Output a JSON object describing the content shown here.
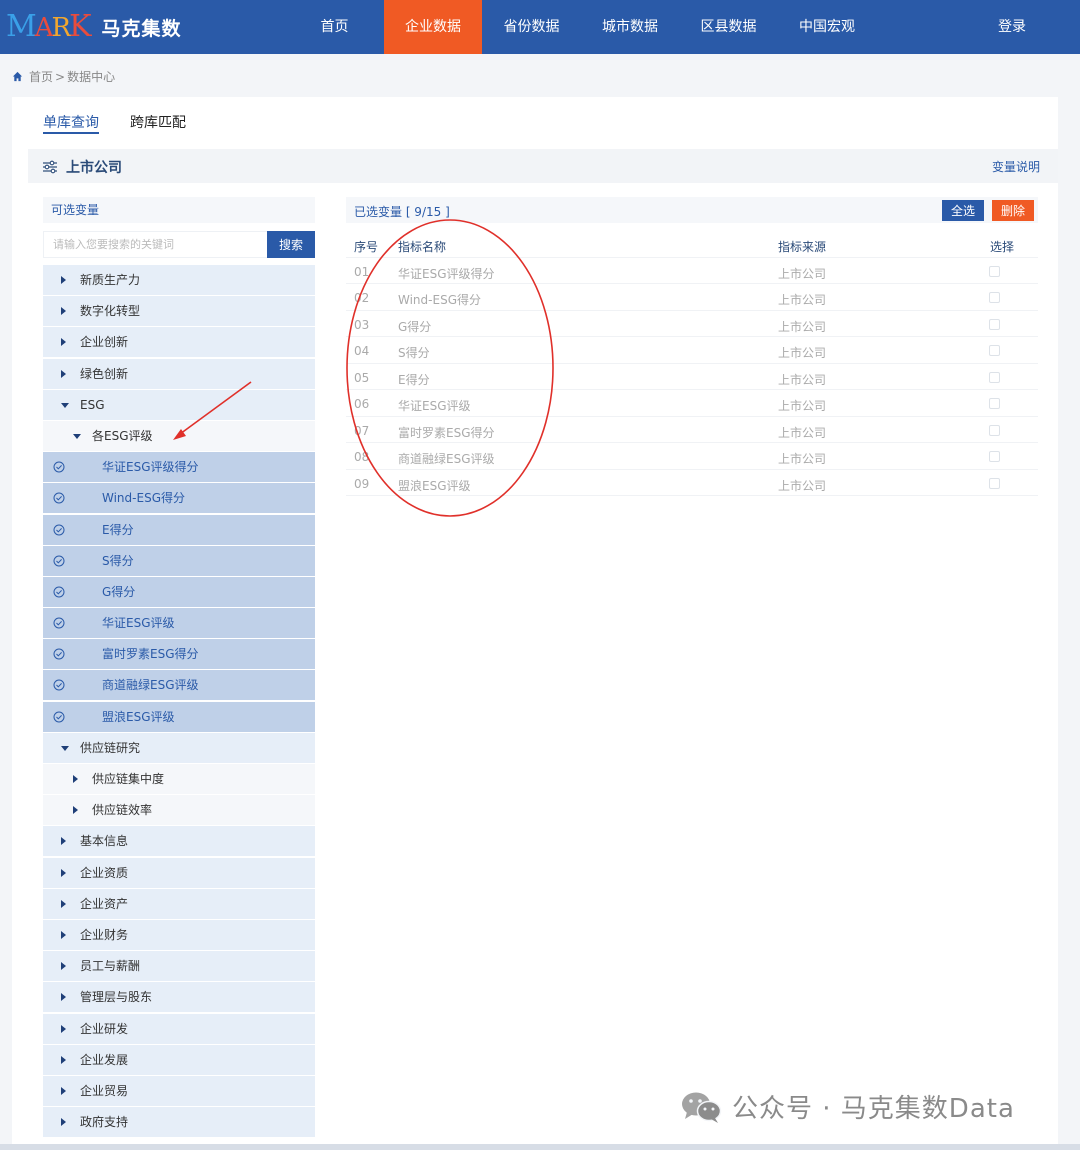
{
  "brand": {
    "logo_text": "MARK",
    "name": "马克集数"
  },
  "nav": {
    "items": [
      "首页",
      "企业数据",
      "省份数据",
      "城市数据",
      "区县数据",
      "中国宏观"
    ],
    "active": "企业数据",
    "login": "登录"
  },
  "breadcrumb": {
    "home": "首页",
    "separator": ">",
    "current": "数据中心"
  },
  "tabs": {
    "single": "单库查询",
    "cross": "跨库匹配"
  },
  "section": {
    "title": "上市公司",
    "explain_link": "变量说明"
  },
  "left_panel": {
    "header": "可选变量",
    "search_placeholder": "请输入您要搜索的关键词",
    "search_button": "搜索",
    "tree": [
      {
        "label": "新质生产力",
        "level": 1,
        "expanded": false
      },
      {
        "label": "数字化转型",
        "level": 1,
        "expanded": false
      },
      {
        "label": "企业创新",
        "level": 1,
        "expanded": false
      },
      {
        "label": "绿色创新",
        "level": 1,
        "expanded": false
      },
      {
        "label": "ESG",
        "level": 1,
        "expanded": true
      },
      {
        "label": "各ESG评级",
        "level": 2,
        "expanded": true
      },
      {
        "label": "华证ESG评级得分",
        "level": 3,
        "checked": true
      },
      {
        "label": "Wind-ESG得分",
        "level": 3,
        "checked": true
      },
      {
        "label": "E得分",
        "level": 3,
        "checked": true
      },
      {
        "label": "S得分",
        "level": 3,
        "checked": true
      },
      {
        "label": "G得分",
        "level": 3,
        "checked": true
      },
      {
        "label": "华证ESG评级",
        "level": 3,
        "checked": true
      },
      {
        "label": "富时罗素ESG得分",
        "level": 3,
        "checked": true
      },
      {
        "label": "商道融绿ESG评级",
        "level": 3,
        "checked": true
      },
      {
        "label": "盟浪ESG评级",
        "level": 3,
        "checked": true
      },
      {
        "label": "供应链研究",
        "level": 1,
        "expanded": true
      },
      {
        "label": "供应链集中度",
        "level": 2,
        "expanded": false
      },
      {
        "label": "供应链效率",
        "level": 2,
        "expanded": false
      },
      {
        "label": "基本信息",
        "level": 1,
        "expanded": false
      },
      {
        "label": "企业资质",
        "level": 1,
        "expanded": false
      },
      {
        "label": "企业资产",
        "level": 1,
        "expanded": false
      },
      {
        "label": "企业财务",
        "level": 1,
        "expanded": false
      },
      {
        "label": "员工与薪酬",
        "level": 1,
        "expanded": false
      },
      {
        "label": "管理层与股东",
        "level": 1,
        "expanded": false
      },
      {
        "label": "企业研发",
        "level": 1,
        "expanded": false
      },
      {
        "label": "企业发展",
        "level": 1,
        "expanded": false
      },
      {
        "label": "企业贸易",
        "level": 1,
        "expanded": false
      },
      {
        "label": "政府支持",
        "level": 1,
        "expanded": false
      }
    ]
  },
  "right_panel": {
    "header": "已选变量 [ 9/15 ]",
    "select_all": "全选",
    "delete": "删除",
    "columns": [
      "序号",
      "指标名称",
      "指标来源",
      "选择"
    ],
    "rows": [
      {
        "seq": "01",
        "name": "华证ESG评级得分",
        "source": "上市公司"
      },
      {
        "seq": "02",
        "name": "Wind-ESG得分",
        "source": "上市公司"
      },
      {
        "seq": "03",
        "name": "G得分",
        "source": "上市公司"
      },
      {
        "seq": "04",
        "name": "S得分",
        "source": "上市公司"
      },
      {
        "seq": "05",
        "name": "E得分",
        "source": "上市公司"
      },
      {
        "seq": "06",
        "name": "华证ESG评级",
        "source": "上市公司"
      },
      {
        "seq": "07",
        "name": "富时罗素ESG得分",
        "source": "上市公司"
      },
      {
        "seq": "08",
        "name": "商道融绿ESG评级",
        "source": "上市公司"
      },
      {
        "seq": "09",
        "name": "盟浪ESG评级",
        "source": "上市公司"
      }
    ]
  },
  "watermark": {
    "text": "公众号 · 马克集数Data"
  },
  "colors": {
    "primary": "#2a5aa8",
    "accent": "#f05a24",
    "leaf_bg": "#bfd0e8",
    "annotation": "#e0302a"
  }
}
